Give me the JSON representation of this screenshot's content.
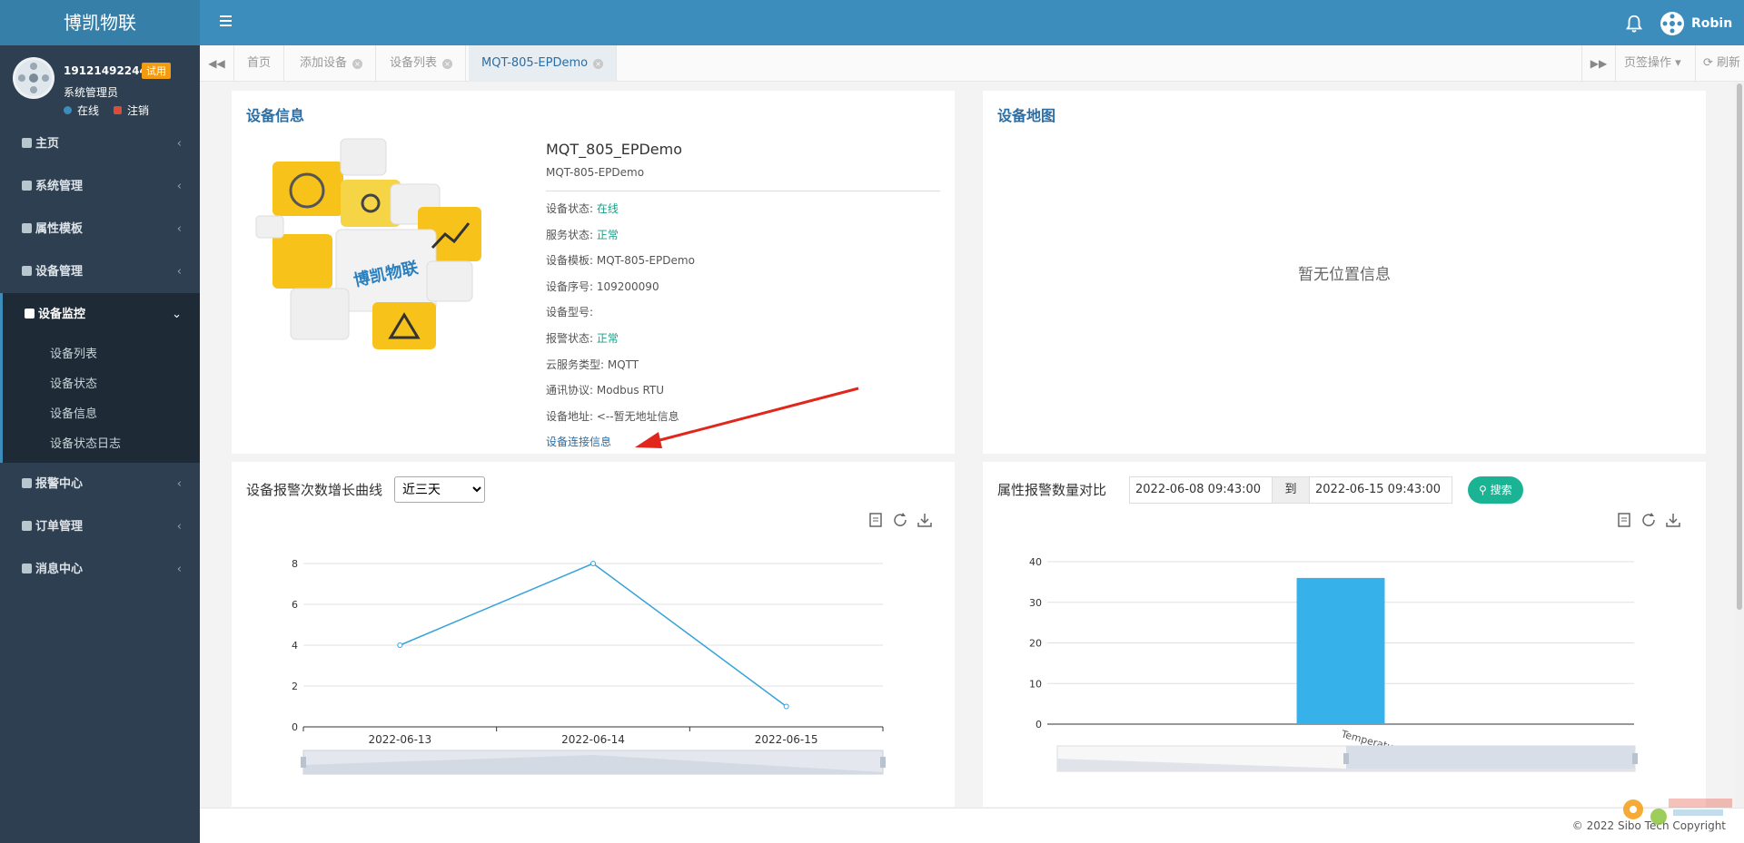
{
  "app": {
    "title": "博凯物联"
  },
  "topbar": {
    "user_name": "Robin"
  },
  "user_panel": {
    "phone": "19121492244",
    "badge": "试用",
    "role": "系统管理员",
    "status_online": "在线",
    "logout": "注销"
  },
  "sidebar": {
    "items": [
      {
        "label": "主页",
        "icon": "home-icon"
      },
      {
        "label": "系统管理",
        "icon": "gear-icon"
      },
      {
        "label": "属性模板",
        "icon": "bookmark-icon"
      },
      {
        "label": "设备管理",
        "icon": "database-icon"
      },
      {
        "label": "设备监控",
        "icon": "dashboard-icon"
      },
      {
        "label": "报警中心",
        "icon": "map-marker-icon"
      },
      {
        "label": "订单管理",
        "icon": "cube-icon"
      },
      {
        "label": "消息中心",
        "icon": "comment-icon"
      }
    ],
    "submenu": [
      "设备列表",
      "设备状态",
      "设备信息",
      "设备状态日志"
    ]
  },
  "tabs": {
    "items": [
      "首页",
      "添加设备",
      "设备列表",
      "MQT-805-EPDemo"
    ],
    "ops": "页签操作",
    "refresh": "刷新"
  },
  "device_info": {
    "title": "设备信息",
    "image_label": "博凯物联",
    "name": "MQT_805_EPDemo",
    "code": "MQT-805-EPDemo",
    "fields": [
      {
        "label": "设备状态: ",
        "value": "在线",
        "ok": true
      },
      {
        "label": "服务状态: ",
        "value": "正常",
        "ok": true
      },
      {
        "label": "设备模板: ",
        "value": "MQT-805-EPDemo",
        "ok": false
      },
      {
        "label": "设备序号: ",
        "value": "109200090",
        "ok": false
      },
      {
        "label": "设备型号: ",
        "value": "",
        "ok": false
      },
      {
        "label": "报警状态: ",
        "value": "正常",
        "ok": true
      },
      {
        "label": "云服务类型: ",
        "value": "MQTT",
        "ok": false
      },
      {
        "label": "通讯协议: ",
        "value": "Modbus RTU",
        "ok": false
      },
      {
        "label": "设备地址: ",
        "value": "<--暂无地址信息",
        "ok": false
      }
    ],
    "link": "设备连接信息"
  },
  "device_map": {
    "title": "设备地图",
    "empty": "暂无位置信息"
  },
  "alarm_curve": {
    "title": "设备报警次数增长曲线",
    "range_selected": "近三天"
  },
  "attr_compare": {
    "title": "属性报警数量对比",
    "date_from": "2022-06-08 09:43:00",
    "to_label": "到",
    "date_to": "2022-06-15 09:43:00",
    "search_label": "搜索"
  },
  "chart_data": [
    {
      "type": "line",
      "x": [
        "2022-06-13",
        "2022-06-14",
        "2022-06-15"
      ],
      "series": [
        {
          "values": [
            4,
            8,
            1
          ]
        }
      ],
      "ylim": [
        0,
        8
      ],
      "yticks": [
        0,
        2,
        4,
        6,
        8
      ],
      "color": "#37a2da",
      "grid": true
    },
    {
      "type": "bar",
      "categories": [
        "Temperature"
      ],
      "values": [
        36
      ],
      "ylim": [
        0,
        40
      ],
      "yticks": [
        0,
        10,
        20,
        30,
        40
      ],
      "color": "#37b1e9",
      "grid": true
    }
  ],
  "footer": {
    "copyright": "© 2022 Sibo Tech Copyright"
  },
  "colors": {
    "topbar": "#3c8dbc",
    "sidebar": "#2d3f51",
    "accent": "#2a6ea5",
    "ok": "#1a9f88",
    "search": "#1ab394"
  }
}
